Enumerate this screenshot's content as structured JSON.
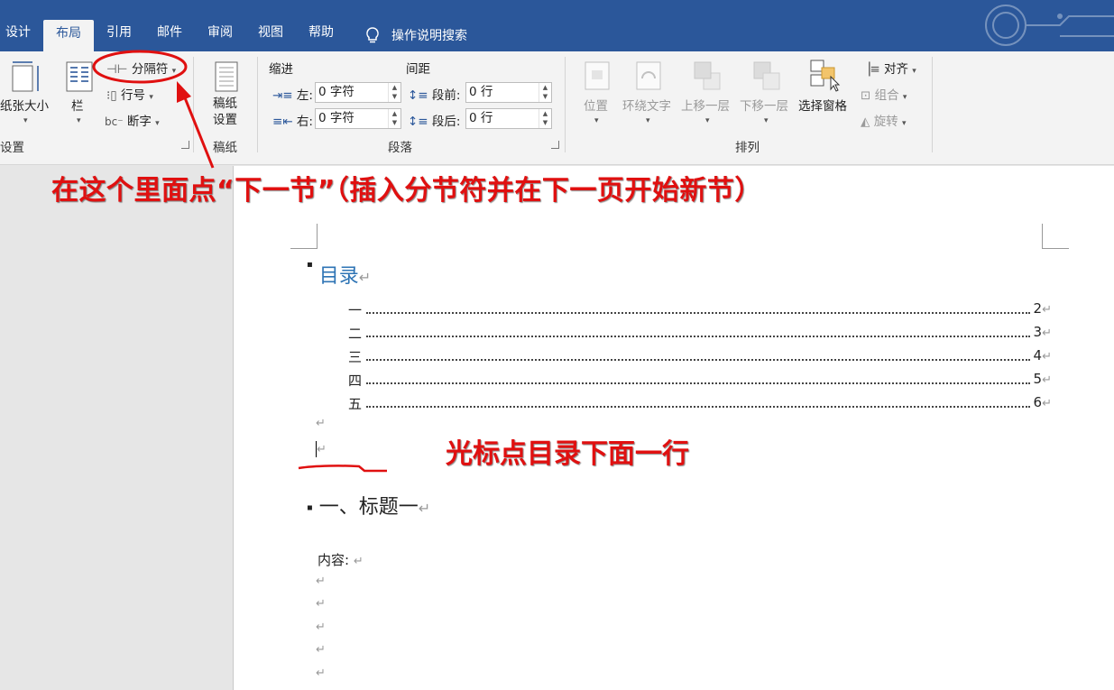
{
  "tabs": [
    "设计",
    "布局",
    "引用",
    "邮件",
    "审阅",
    "视图",
    "帮助"
  ],
  "tell_me": "操作说明搜索",
  "ribbon": {
    "page_setup": {
      "size_label": "纸张大小",
      "columns_label": "栏",
      "breaks_label": "分隔符",
      "line_numbers_label": "行号",
      "hyphenation_label": "断字",
      "group_label": "设置"
    },
    "draft": {
      "button_label_1": "稿纸",
      "button_label_2": "设置",
      "group_label": "稿纸"
    },
    "paragraph": {
      "indent_header": "缩进",
      "spacing_header": "间距",
      "left_label": "左:",
      "right_label": "右:",
      "before_label": "段前:",
      "after_label": "段后:",
      "left_value": "0 字符",
      "right_value": "0 字符",
      "before_value": "0 行",
      "after_value": "0 行",
      "group_label": "段落"
    },
    "arrange": {
      "position_label": "位置",
      "wrap_text_label": "环绕文字",
      "bring_forward_label": "上移一层",
      "send_backward_label": "下移一层",
      "selection_pane_label": "选择窗格",
      "align_label": "对齐",
      "group_label_small": "组合",
      "rotate_label": "旋转",
      "group_label": "排列"
    }
  },
  "document": {
    "toc_title": "目录",
    "toc_entries": [
      {
        "label": "一",
        "page": "2"
      },
      {
        "label": "二",
        "page": "3"
      },
      {
        "label": "三",
        "page": "4"
      },
      {
        "label": "四",
        "page": "5"
      },
      {
        "label": "五",
        "page": "6"
      }
    ],
    "heading": "一、标题一",
    "content_label": "内容:",
    "paragraph_mark": "↵"
  },
  "annotations": {
    "top": "在这个里面点“下一节”（插入分节符并在下一页开始新节）",
    "middle": "光标点目录下面一行"
  },
  "colors": {
    "title_bar": "#2b579a",
    "ribbon": "#f3f3f3",
    "annotation": "#e01010",
    "toc_title": "#2e74b5"
  }
}
